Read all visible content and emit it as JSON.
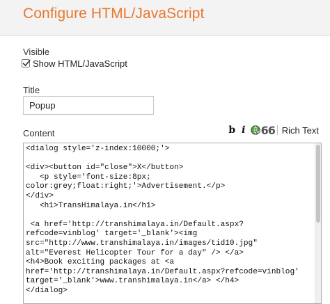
{
  "dialog": {
    "title": "Configure HTML/JavaScript"
  },
  "visible": {
    "label": "Visible",
    "checkbox_label": "Show HTML/JavaScript",
    "checked": true
  },
  "title_field": {
    "label": "Title",
    "value": "Popup"
  },
  "content": {
    "label": "Content",
    "toolbar": {
      "bold_label": "b",
      "italic_label": "i",
      "link_icon": "link-icon",
      "quote_label": "66",
      "rich_text_label": "Rich Text"
    },
    "lines": [
      "<dialog style='z-index:10000;'>",
      "",
      "<div><button id=\"close\">X</button>",
      "   <p style='font-size:8px;",
      "color:grey;float:right;'>Advertisement.</p>",
      "</div>",
      "   <h1>TransHimalaya.in</h1>",
      "",
      " <a href='http://transhimalaya.in/Default.aspx?",
      "refcode=vinblog' target='_blank'><img",
      "src=\"http://www.transhimalaya.in/images/tid10.jpg\"",
      "alt=\"Everest Helicopter Tour for a day\" /> </a>",
      "<h4>Book exciting packages at <a",
      "href='http://transhimalaya.in/Default.aspx?refcode=vinblog'",
      "target='_blank'>www.transhimalaya.in</a> </h4>",
      "</dialog>"
    ]
  }
}
